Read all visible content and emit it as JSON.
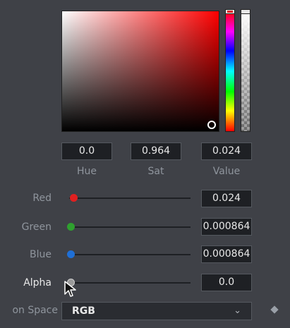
{
  "hsv": {
    "hue": "0.0",
    "sat": "0.964",
    "value": "0.024",
    "hue_label": "Hue",
    "sat_label": "Sat",
    "value_label": "Value"
  },
  "channels": {
    "red": {
      "label": "Red",
      "value": "0.024",
      "slider_fraction": 0.024,
      "color": "#e02020"
    },
    "green": {
      "label": "Green",
      "value": "0.000864",
      "slider_fraction": 0.000864,
      "color": "#2fa02f"
    },
    "blue": {
      "label": "Blue",
      "value": "0.000864",
      "slider_fraction": 0.000864,
      "color": "#1f6fd6"
    },
    "alpha": {
      "label": "Alpha",
      "value": "0.0",
      "slider_fraction": 0.0,
      "color": "#9a9a9a"
    }
  },
  "color_space": {
    "label": "on Space",
    "value": "RGB",
    "chevron_icon": "chevron-down-icon",
    "keyframe_icon": "diamond-icon"
  },
  "cursor_icon": "arrow-pointer-icon"
}
